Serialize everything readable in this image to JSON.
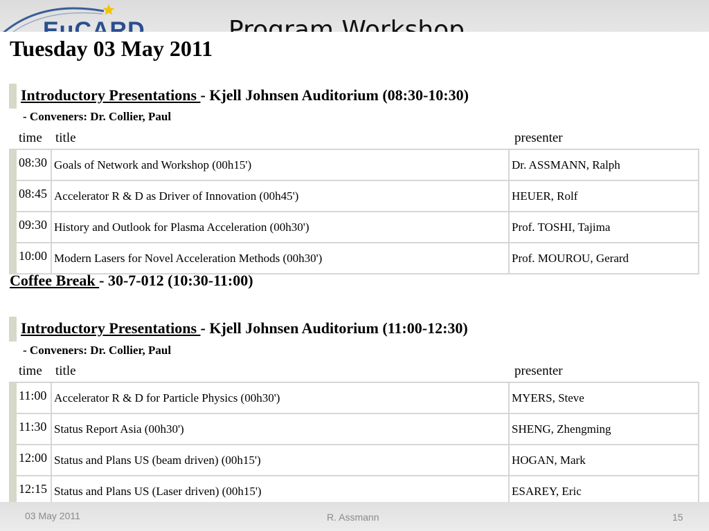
{
  "header": {
    "logo_text": "EuCARD",
    "title": "Program Workshop"
  },
  "day": "Tuesday 03 May 2011",
  "columns": {
    "time": "time",
    "title": "title",
    "presenter": "presenter"
  },
  "sessions": [
    {
      "link": "Introductory Presentations ",
      "rest": "- Kjell Johnsen Auditorium (08:30-10:30)",
      "conveners": "- Conveners: Dr. Collier, Paul",
      "rows": [
        {
          "time": "08:30",
          "title": "Goals of Network and Workshop (00h15')",
          "presenter": "Dr. ASSMANN, Ralph"
        },
        {
          "time": "08:45",
          "title": "Accelerator R & D as Driver of Innovation (00h45')",
          "presenter": "HEUER, Rolf"
        },
        {
          "time": "09:30",
          "title": "History and Outlook for Plasma Acceleration (00h30')",
          "presenter": "Prof. TOSHI, Tajima"
        },
        {
          "time": "10:00",
          "title": "Modern Lasers for Novel Acceleration Methods (00h30')",
          "presenter": "Prof. MOUROU, Gerard"
        }
      ]
    },
    {
      "link": "Introductory Presentations ",
      "rest": "- Kjell Johnsen Auditorium (11:00-12:30)",
      "conveners": "- Conveners: Dr. Collier, Paul",
      "rows": [
        {
          "time": "11:00",
          "title": "Accelerator R & D for Particle Physics (00h30')",
          "presenter": "MYERS, Steve"
        },
        {
          "time": "11:30",
          "title": "Status Report Asia (00h30')",
          "presenter": "SHENG, Zhengming"
        },
        {
          "time": "12:00",
          "title": "Status and Plans US (beam driven) (00h15')",
          "presenter": "HOGAN, Mark"
        },
        {
          "time": "12:15",
          "title": "Status and Plans US (Laser driven) (00h15')",
          "presenter": "ESAREY, Eric"
        }
      ]
    }
  ],
  "coffee_break": {
    "link": "Coffee Break ",
    "rest": "- 30-7-012 (10:30-11:00)"
  },
  "footer": {
    "date": "03 May 2011",
    "author": "R. Assmann",
    "page": "15"
  },
  "colors": {
    "logo_blue": "#2a4f8f",
    "star_yellow": "#f2c400",
    "session_bar": "#d8d8c8"
  }
}
